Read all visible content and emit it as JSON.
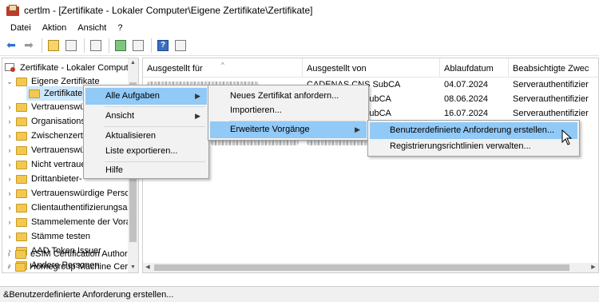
{
  "window": {
    "title": "certlm - [Zertifikate - Lokaler Computer\\Eigene Zertifikate\\Zertifikate]"
  },
  "menubar": {
    "items": [
      "Datei",
      "Aktion",
      "Ansicht",
      "?"
    ]
  },
  "toolbar": {
    "icons": [
      "back-arrow-icon",
      "forward-arrow-icon",
      "up-folder-icon",
      "show-hide-tree-icon",
      "clipboard-icon",
      "refresh-icon",
      "export-list-icon",
      "help-icon",
      "properties-icon"
    ]
  },
  "tree": {
    "root": "Zertifikate - Lokaler Compute",
    "items": [
      {
        "label": "Eigene Zertifikate",
        "expanded": true
      },
      {
        "label": "Zertifikate",
        "selected": true
      },
      {
        "label": "Vertrauenswü"
      },
      {
        "label": "Organisations"
      },
      {
        "label": "Zwischenzerti"
      },
      {
        "label": "Vertrauenswü"
      },
      {
        "label": "Nicht vertraue"
      },
      {
        "label": "Drittanbieter-"
      },
      {
        "label": "Vertrauenswürdige Personen"
      },
      {
        "label": "Clientauthentifizierungsau"
      },
      {
        "label": "Stammelemente der Vorab"
      },
      {
        "label": "Stämme testen"
      },
      {
        "label": "AAD Token Issuer"
      },
      {
        "label": "Andere Personen"
      },
      {
        "label": "eSIM Certification Authori"
      },
      {
        "label": "Homegroup Machine Cer"
      }
    ]
  },
  "list": {
    "columns": [
      "Ausgestellt für",
      "Ausgestellt von",
      "Ablaufdatum",
      "Beabsichtigte Zwec"
    ],
    "rows": [
      {
        "issuer": "CADENAS CNS SubCA",
        "expires": "04.07.2024",
        "purpose": "Serverauthentifizier"
      },
      {
        "issuer": "SubCA",
        "expires": "08.06.2024",
        "purpose": "Serverauthentifizier"
      },
      {
        "issuer": "SubCA",
        "expires": "16.07.2024",
        "purpose": "Serverauthentifizier"
      },
      {
        "issuer": "",
        "expires": "",
        "purpose": ""
      },
      {
        "issuer": "",
        "expires": "",
        "purpose": ""
      }
    ]
  },
  "context_menu": {
    "items": [
      "Alle Aufgaben",
      "Ansicht",
      "Aktualisieren",
      "Liste exportieren...",
      "Hilfe"
    ]
  },
  "submenu_tasks": {
    "items": [
      "Neues Zertifikat anfordern...",
      "Importieren...",
      "Erweiterte Vorgänge"
    ]
  },
  "submenu_advanced": {
    "items": [
      "Benutzerdefinierte Anforderung erstellen...",
      "Registrierungsrichtlinien verwalten..."
    ]
  },
  "status": {
    "text": "&Benutzerdefinierte Anforderung erstellen..."
  },
  "colors": {
    "highlight": "#91c9f7",
    "selection": "#cce8ff",
    "folder": "#f3c850"
  }
}
